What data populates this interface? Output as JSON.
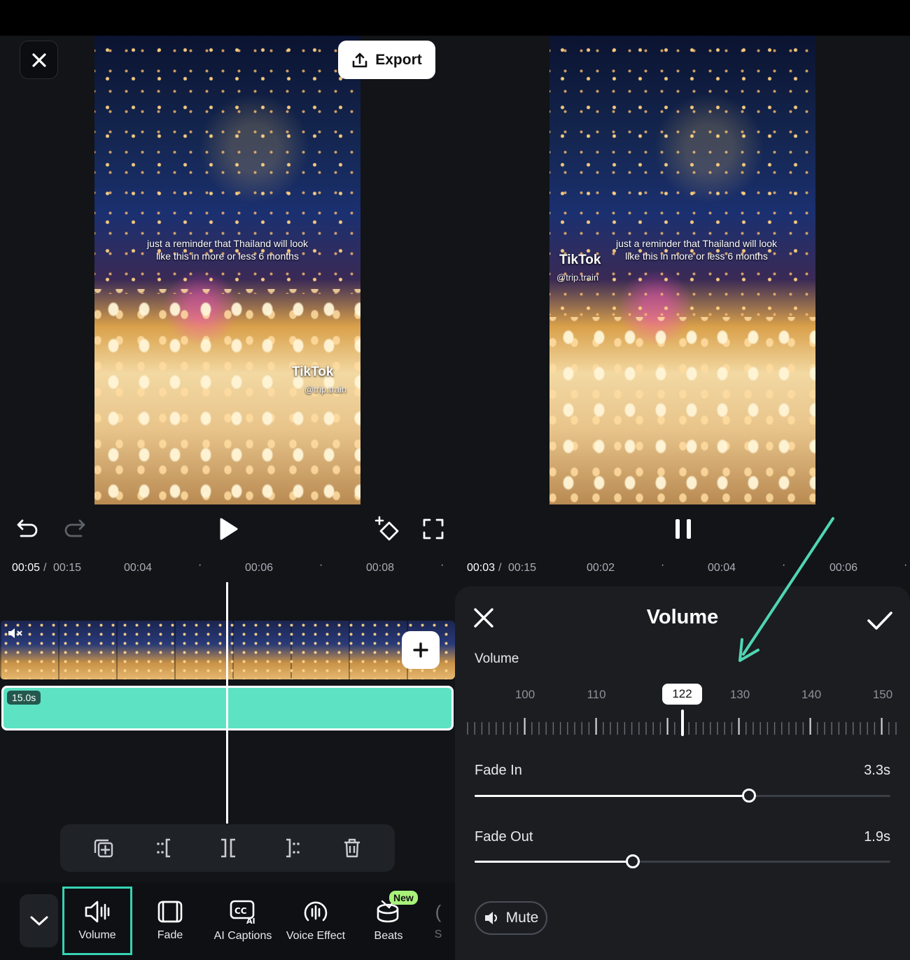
{
  "left_editor": {
    "close_label": "",
    "export_label": "Export",
    "left_video": {
      "caption_line1": "just a reminder that Thailand will look",
      "caption_line2": "like this in more or less 6 months",
      "watermark": "TikTok",
      "handle": "@trip.train"
    },
    "ruler": {
      "current": "00:05",
      "separator": " / ",
      "total": "00:15",
      "marks": [
        "00:04",
        "00:06",
        "00:08"
      ]
    },
    "audio_clip": {
      "duration": "15.0s"
    },
    "bottom_tools": [
      {
        "label": "Volume",
        "icon": "volume-icon",
        "selected": true
      },
      {
        "label": "Fade",
        "icon": "fade-icon",
        "selected": false
      },
      {
        "label": "AI Captions",
        "icon": "ai-captions-icon",
        "selected": false
      },
      {
        "label": "Voice Effect",
        "icon": "voice-effect-icon",
        "selected": false
      },
      {
        "label": "Beats",
        "icon": "beats-icon",
        "selected": false,
        "badge": "New"
      },
      {
        "label": "S",
        "icon": "more-icon",
        "selected": false
      }
    ]
  },
  "right_editor": {
    "right_video": {
      "caption_line1": "just a reminder that Thailand will look",
      "caption_line2": "like this in more or less 6 months",
      "watermark": "TikTok",
      "handle": "@trip.train"
    },
    "ruler": {
      "current": "00:03",
      "separator": " / ",
      "total": "00:15",
      "marks": [
        "00:02",
        "00:04",
        "00:06"
      ]
    },
    "volume_panel": {
      "title": "Volume",
      "volume_label": "Volume",
      "volume_value": "122",
      "scale": [
        "100",
        "110",
        "130",
        "140",
        "150"
      ],
      "fade_in_label": "Fade In",
      "fade_in_value": "3.3s",
      "fade_in_fraction": 0.66,
      "fade_out_label": "Fade Out",
      "fade_out_value": "1.9s",
      "fade_out_fraction": 0.38,
      "mute_label": "Mute"
    }
  },
  "colors": {
    "accent": "#5de3c4",
    "selection_outline": "#35d4b3",
    "new_badge": "#a8f27a",
    "annotation_arrow": "#4fd6b4"
  }
}
